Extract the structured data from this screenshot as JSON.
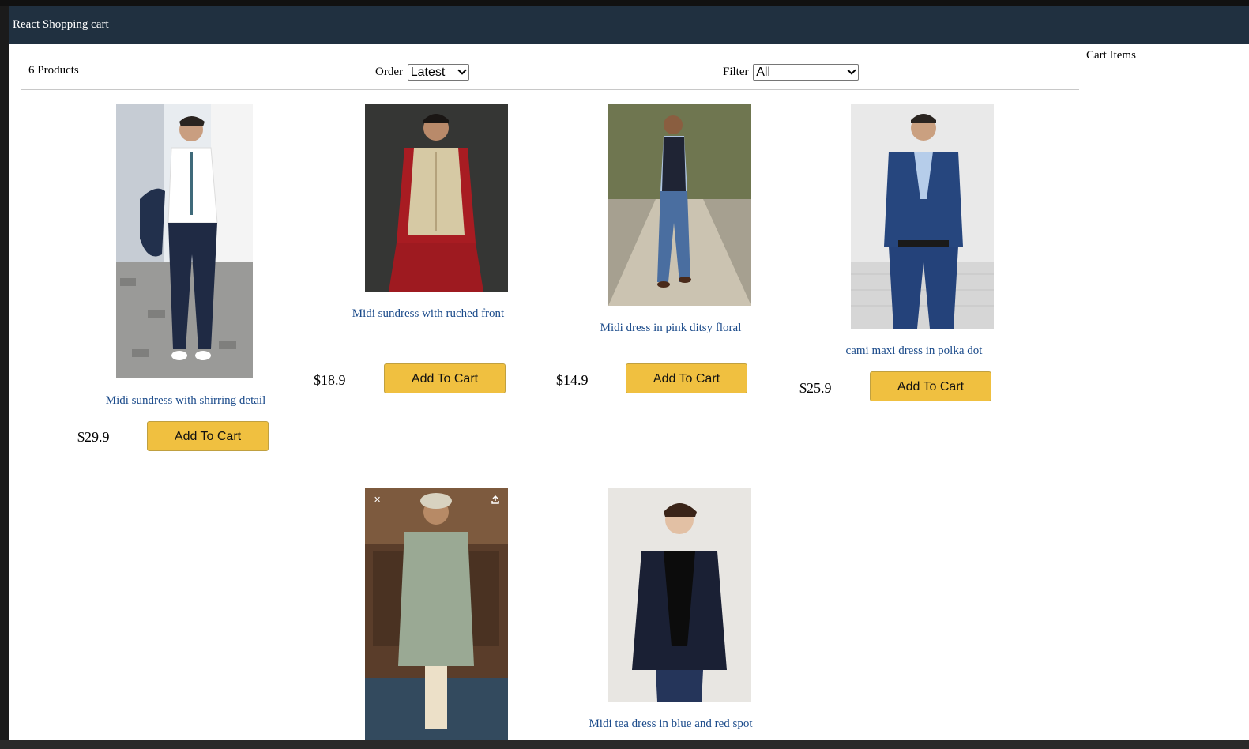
{
  "header": {
    "title": "React Shopping cart"
  },
  "filter_bar": {
    "count_label": "6 Products",
    "order_label": "Order",
    "order_value": "Latest",
    "filter_label": "Filter",
    "filter_value": "All"
  },
  "products": [
    {
      "name": "Midi sundress with shirring detail",
      "price": "$29.9",
      "button": "Add To Cart"
    },
    {
      "name": "Midi sundress with ruched front",
      "price": "$18.9",
      "button": "Add To Cart"
    },
    {
      "name": "Midi dress in pink ditsy floral",
      "price": "$14.9",
      "button": "Add To Cart"
    },
    {
      "name": "cami maxi dress in polka dot",
      "price": "$25.9",
      "button": "Add To Cart"
    },
    {
      "name": "",
      "price": "",
      "button": ""
    },
    {
      "name": "Midi tea dress in blue and red spot",
      "price": "",
      "button": ""
    }
  ],
  "cart": {
    "title": "Cart Items"
  },
  "icons": [
    "close-icon",
    "share-icon"
  ],
  "colors": {
    "header_bg": "#203040",
    "button_bg": "#f0c040",
    "link": "#1a4a8a"
  }
}
